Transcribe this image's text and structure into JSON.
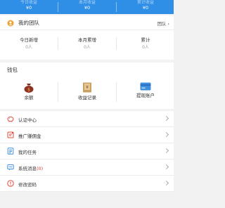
{
  "summary": {
    "columns": [
      {
        "label": "今日收益",
        "value": "¥0"
      },
      {
        "label": "本月收益",
        "value": "¥0"
      },
      {
        "label": "累计收益",
        "value": "¥0"
      }
    ]
  },
  "team": {
    "title": "我的团队",
    "link": "团队",
    "stats": [
      {
        "label": "今日新增",
        "value": "0人"
      },
      {
        "label": "本月累增",
        "value": "0人"
      },
      {
        "label": "累计",
        "value": "0人"
      }
    ]
  },
  "wallet": {
    "title": "钱包",
    "items": [
      {
        "label": "余额",
        "icon": "money-bag-icon"
      },
      {
        "label": "收益记录",
        "icon": "ledger-book-icon"
      },
      {
        "label": "提现账户",
        "icon": "card-icon"
      }
    ]
  },
  "menu": {
    "items": [
      {
        "label": "认证中心",
        "icon": "piggy-bank-icon"
      },
      {
        "label": "推广赚佣金",
        "icon": "promote-icon"
      },
      {
        "label": "我的任务",
        "icon": "task-list-icon"
      },
      {
        "label": "系统消息",
        "badge": "(0)",
        "icon": "message-icon"
      },
      {
        "label": "修改密码",
        "icon": "alert-circle-icon"
      }
    ]
  },
  "colors": {
    "accent": "#2f8fe6",
    "icon_orange": "#f0a02c",
    "icon_red": "#e4493f",
    "icon_blue": "#3f8fe0"
  }
}
